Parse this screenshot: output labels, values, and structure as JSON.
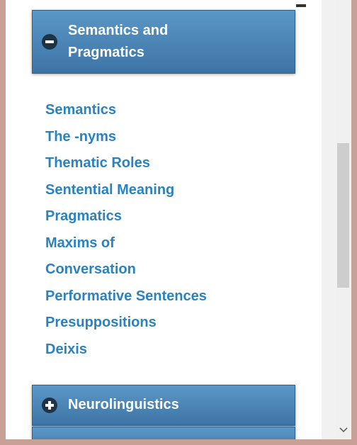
{
  "sections": [
    {
      "title_line1": "Semantics and",
      "title_line2": "Pragmatics",
      "state": "expanded",
      "icon": "minus-circle-icon",
      "items": [
        "Semantics",
        "The -nyms",
        "Thematic Roles",
        "Sentential Meaning",
        "Pragmatics",
        "Maxims of",
        "Conversation",
        "Performative Sentences",
        "Presuppositions",
        "Deixis"
      ]
    },
    {
      "title": "Neurolinguistics",
      "state": "collapsed",
      "icon": "plus-circle-icon"
    }
  ],
  "colors": {
    "header_top": "#5b97c6",
    "header_bottom": "#3c74a6",
    "link": "#2b82c1"
  }
}
